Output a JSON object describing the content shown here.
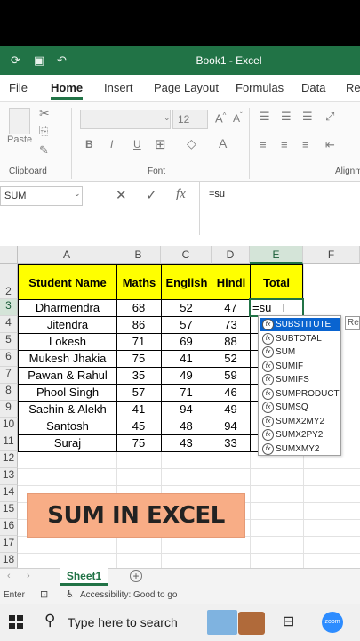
{
  "window": {
    "title": "Book1  -  Excel"
  },
  "ribbon_tabs": [
    "File",
    "Home",
    "Insert",
    "Page Layout",
    "Formulas",
    "Data",
    "Rev"
  ],
  "ribbon": {
    "paste_label": "Paste",
    "clipboard_label": "Clipboard",
    "font_label": "Font",
    "alignment_label": "Alignm",
    "font_size": "12",
    "bold": "B",
    "italic": "I",
    "underline": "U"
  },
  "formula_bar": {
    "name_box": "SUM",
    "formula": "=su",
    "cancel": "✕",
    "enter": "✓",
    "fx": "fx"
  },
  "columns": [
    "A",
    "B",
    "C",
    "D",
    "E",
    "F"
  ],
  "rows": [
    "2",
    "3",
    "4",
    "5",
    "6",
    "7",
    "8",
    "9",
    "10",
    "11",
    "12",
    "13",
    "14",
    "15",
    "16",
    "17",
    "18"
  ],
  "table": {
    "headers": [
      "Student Name",
      "Maths",
      "English",
      "Hindi",
      "Total"
    ],
    "rows": [
      [
        "Dharmendra",
        "68",
        "52",
        "47"
      ],
      [
        "Jitendra",
        "86",
        "57",
        "73"
      ],
      [
        "Lokesh",
        "71",
        "69",
        "88"
      ],
      [
        "Mukesh Jhakia",
        "75",
        "41",
        "52"
      ],
      [
        "Pawan & Rahul",
        "35",
        "49",
        "59"
      ],
      [
        "Phool Singh",
        "57",
        "71",
        "46"
      ],
      [
        "Sachin & Alekh",
        "41",
        "94",
        "49"
      ],
      [
        "Santosh",
        "45",
        "48",
        "94"
      ],
      [
        "Suraj",
        "75",
        "43",
        "33"
      ]
    ],
    "active_value": "=su"
  },
  "autocomplete": {
    "items": [
      "SUBSTITUTE",
      "SUBTOTAL",
      "SUM",
      "SUMIF",
      "SUMIFS",
      "SUMPRODUCT",
      "SUMSQ",
      "SUMX2MY2",
      "SUMX2PY2",
      "SUMXMY2"
    ],
    "selected_index": 0,
    "tooltip": "Re"
  },
  "banner": "SUM IN EXCEL",
  "sheets": {
    "active": "Sheet1",
    "add": "+"
  },
  "status": {
    "mode": "Enter",
    "accessibility": "Accessibility: Good to go"
  },
  "taskbar": {
    "search_placeholder": "Type here to search",
    "zoom_label": "zoom"
  },
  "colors": {
    "excel_green": "#217346",
    "header_yellow": "#ffff00",
    "banner_fill": "#f8ad86",
    "selection_blue": "#0a64d0"
  }
}
